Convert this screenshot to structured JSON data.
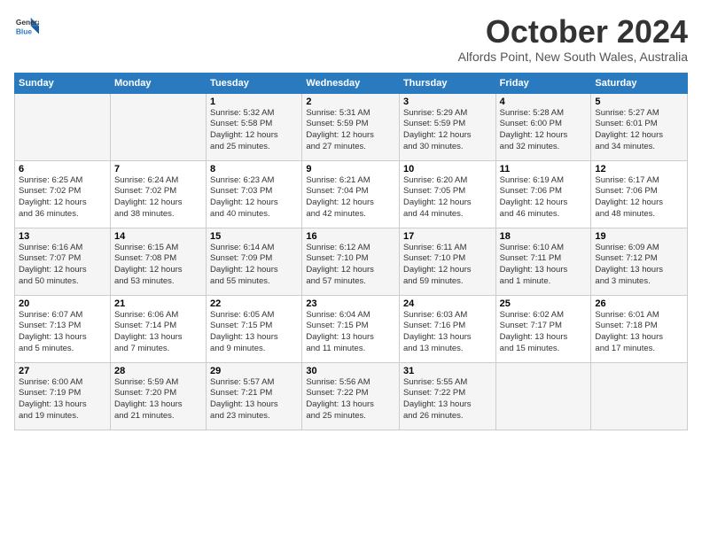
{
  "logo": {
    "line1": "General",
    "line2": "Blue"
  },
  "title": "October 2024",
  "subtitle": "Alfords Point, New South Wales, Australia",
  "days_header": [
    "Sunday",
    "Monday",
    "Tuesday",
    "Wednesday",
    "Thursday",
    "Friday",
    "Saturday"
  ],
  "weeks": [
    [
      {
        "day": "",
        "content": ""
      },
      {
        "day": "",
        "content": ""
      },
      {
        "day": "1",
        "content": "Sunrise: 5:32 AM\nSunset: 5:58 PM\nDaylight: 12 hours\nand 25 minutes."
      },
      {
        "day": "2",
        "content": "Sunrise: 5:31 AM\nSunset: 5:59 PM\nDaylight: 12 hours\nand 27 minutes."
      },
      {
        "day": "3",
        "content": "Sunrise: 5:29 AM\nSunset: 5:59 PM\nDaylight: 12 hours\nand 30 minutes."
      },
      {
        "day": "4",
        "content": "Sunrise: 5:28 AM\nSunset: 6:00 PM\nDaylight: 12 hours\nand 32 minutes."
      },
      {
        "day": "5",
        "content": "Sunrise: 5:27 AM\nSunset: 6:01 PM\nDaylight: 12 hours\nand 34 minutes."
      }
    ],
    [
      {
        "day": "6",
        "content": "Sunrise: 6:25 AM\nSunset: 7:02 PM\nDaylight: 12 hours\nand 36 minutes."
      },
      {
        "day": "7",
        "content": "Sunrise: 6:24 AM\nSunset: 7:02 PM\nDaylight: 12 hours\nand 38 minutes."
      },
      {
        "day": "8",
        "content": "Sunrise: 6:23 AM\nSunset: 7:03 PM\nDaylight: 12 hours\nand 40 minutes."
      },
      {
        "day": "9",
        "content": "Sunrise: 6:21 AM\nSunset: 7:04 PM\nDaylight: 12 hours\nand 42 minutes."
      },
      {
        "day": "10",
        "content": "Sunrise: 6:20 AM\nSunset: 7:05 PM\nDaylight: 12 hours\nand 44 minutes."
      },
      {
        "day": "11",
        "content": "Sunrise: 6:19 AM\nSunset: 7:06 PM\nDaylight: 12 hours\nand 46 minutes."
      },
      {
        "day": "12",
        "content": "Sunrise: 6:17 AM\nSunset: 7:06 PM\nDaylight: 12 hours\nand 48 minutes."
      }
    ],
    [
      {
        "day": "13",
        "content": "Sunrise: 6:16 AM\nSunset: 7:07 PM\nDaylight: 12 hours\nand 50 minutes."
      },
      {
        "day": "14",
        "content": "Sunrise: 6:15 AM\nSunset: 7:08 PM\nDaylight: 12 hours\nand 53 minutes."
      },
      {
        "day": "15",
        "content": "Sunrise: 6:14 AM\nSunset: 7:09 PM\nDaylight: 12 hours\nand 55 minutes."
      },
      {
        "day": "16",
        "content": "Sunrise: 6:12 AM\nSunset: 7:10 PM\nDaylight: 12 hours\nand 57 minutes."
      },
      {
        "day": "17",
        "content": "Sunrise: 6:11 AM\nSunset: 7:10 PM\nDaylight: 12 hours\nand 59 minutes."
      },
      {
        "day": "18",
        "content": "Sunrise: 6:10 AM\nSunset: 7:11 PM\nDaylight: 13 hours\nand 1 minute."
      },
      {
        "day": "19",
        "content": "Sunrise: 6:09 AM\nSunset: 7:12 PM\nDaylight: 13 hours\nand 3 minutes."
      }
    ],
    [
      {
        "day": "20",
        "content": "Sunrise: 6:07 AM\nSunset: 7:13 PM\nDaylight: 13 hours\nand 5 minutes."
      },
      {
        "day": "21",
        "content": "Sunrise: 6:06 AM\nSunset: 7:14 PM\nDaylight: 13 hours\nand 7 minutes."
      },
      {
        "day": "22",
        "content": "Sunrise: 6:05 AM\nSunset: 7:15 PM\nDaylight: 13 hours\nand 9 minutes."
      },
      {
        "day": "23",
        "content": "Sunrise: 6:04 AM\nSunset: 7:15 PM\nDaylight: 13 hours\nand 11 minutes."
      },
      {
        "day": "24",
        "content": "Sunrise: 6:03 AM\nSunset: 7:16 PM\nDaylight: 13 hours\nand 13 minutes."
      },
      {
        "day": "25",
        "content": "Sunrise: 6:02 AM\nSunset: 7:17 PM\nDaylight: 13 hours\nand 15 minutes."
      },
      {
        "day": "26",
        "content": "Sunrise: 6:01 AM\nSunset: 7:18 PM\nDaylight: 13 hours\nand 17 minutes."
      }
    ],
    [
      {
        "day": "27",
        "content": "Sunrise: 6:00 AM\nSunset: 7:19 PM\nDaylight: 13 hours\nand 19 minutes."
      },
      {
        "day": "28",
        "content": "Sunrise: 5:59 AM\nSunset: 7:20 PM\nDaylight: 13 hours\nand 21 minutes."
      },
      {
        "day": "29",
        "content": "Sunrise: 5:57 AM\nSunset: 7:21 PM\nDaylight: 13 hours\nand 23 minutes."
      },
      {
        "day": "30",
        "content": "Sunrise: 5:56 AM\nSunset: 7:22 PM\nDaylight: 13 hours\nand 25 minutes."
      },
      {
        "day": "31",
        "content": "Sunrise: 5:55 AM\nSunset: 7:22 PM\nDaylight: 13 hours\nand 26 minutes."
      },
      {
        "day": "",
        "content": ""
      },
      {
        "day": "",
        "content": ""
      }
    ]
  ]
}
